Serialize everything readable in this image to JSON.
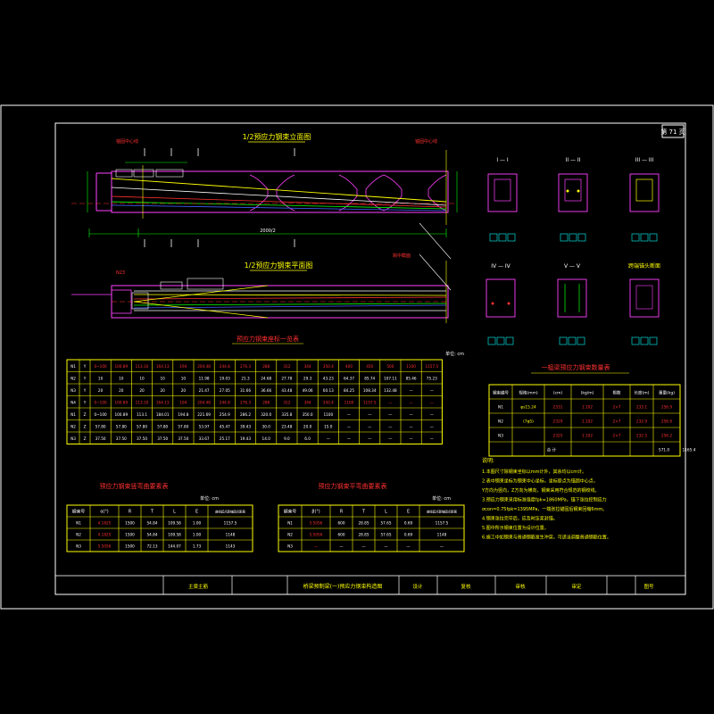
{
  "sheet": {
    "page_label": "第 71 页"
  },
  "elevation": {
    "title": "1/2预应力钢束立面图",
    "anchor_left_label": "锚固中心线",
    "anchor_right_label": "锚固中心线",
    "section_marks": [
      "I",
      "II",
      "III",
      "IV",
      "V"
    ],
    "dim_total": "2000/2"
  },
  "plan": {
    "title": "1/2预应力钢束平面图",
    "left_label": "N23",
    "right_label": "跨中截面"
  },
  "sections": {
    "labels": [
      "I — I",
      "II — II",
      "III — III",
      "IV — IV",
      "V — V",
      "跨端锚头断面"
    ]
  },
  "table_main": {
    "title": "预应力钢束座标一览表",
    "unit": "单位: cm",
    "rows": [
      {
        "c": [
          "N1",
          "Y",
          "0~100",
          "100.89",
          "113.10",
          "164.13",
          "194",
          "204.48",
          "244.8",
          "276.3",
          "288",
          "312",
          "344",
          "350.4",
          "400",
          "450",
          "500",
          "1100",
          "1157.5"
        ]
      },
      {
        "c": [
          "N2",
          "Y",
          "10",
          "10",
          "10",
          "10",
          "10",
          "11.98",
          "19.03",
          "21.3",
          "24.68",
          "27.78",
          "29.3",
          "43.23",
          "64.37",
          "85.74",
          "107.11",
          "85.46",
          "75.23"
        ]
      },
      {
        "c": [
          "N3",
          "Y",
          "20",
          "20",
          "20",
          "20",
          "20",
          "21.47",
          "27.05",
          "31.66",
          "36.66",
          "43.48",
          "49.06",
          "60.13",
          "84.25",
          "108.34",
          "132.48",
          "—",
          "—"
        ]
      },
      {
        "c": [
          "N4",
          "Y",
          "0~100",
          "100.89",
          "113.10",
          "164.13",
          "194",
          "204.48",
          "244.8",
          "276.3",
          "288",
          "312",
          "344",
          "350.4",
          "1100",
          "1157.5",
          "—",
          "—",
          "—"
        ]
      },
      {
        "c": [
          "N1",
          "Z",
          "0~100",
          "100.89",
          "113.1",
          "184.01",
          "194.8",
          "221.69",
          "254.9",
          "286.2",
          "320.0",
          "335.8",
          "350.0",
          "1100",
          "—",
          "—",
          "—",
          "—",
          "—"
        ]
      },
      {
        "c": [
          "N2",
          "Z",
          "57.80",
          "57.80",
          "57.80",
          "57.80",
          "57.80",
          "53.97",
          "45.47",
          "39.43",
          "30.0",
          "23.48",
          "20.0",
          "15.0",
          "—",
          "—",
          "—",
          "—",
          "—"
        ]
      },
      {
        "c": [
          "N3",
          "Z",
          "37.50",
          "37.50",
          "37.50",
          "37.50",
          "37.50",
          "33.67",
          "25.17",
          "19.43",
          "14.0",
          "9.0",
          "6.0",
          "—",
          "—",
          "—",
          "—",
          "—",
          "—"
        ]
      }
    ]
  },
  "table_steel": {
    "title": "一榀梁预应力钢束数量表",
    "headers": [
      "钢束编号",
      "规格(mm)",
      "(cm)",
      "(kg/m)",
      "根数",
      "长度(m)",
      "重量(kg)"
    ],
    "rows": [
      {
        "c": [
          "N1",
          "φs15.24",
          "2331",
          "1.102",
          "2×7",
          "233.1",
          "256.9"
        ]
      },
      {
        "c": [
          "N2",
          "(7φ5)",
          "2329",
          "1.102",
          "2×7",
          "232.9",
          "256.6"
        ]
      },
      {
        "c": [
          "N3",
          "",
          "2325",
          "1.102",
          "2×7",
          "232.5",
          "256.2"
        ]
      }
    ],
    "total_label": "合 计",
    "total_length": "571.0",
    "total_weight": "1165.4"
  },
  "table_vert": {
    "title": "预应力钢束竖弯曲要素表",
    "unit": "单位: cm",
    "headers": [
      "钢束号",
      "α(°)",
      "R",
      "T",
      "L",
      "E",
      "曲线起点距锚固点距离"
    ],
    "rows": [
      {
        "c": [
          "N1",
          "4.1825",
          "1500",
          "54.84",
          "109.58",
          "1.00",
          "1157.5"
        ]
      },
      {
        "c": [
          "N2",
          "4.1825",
          "1500",
          "54.84",
          "109.58",
          "1.00",
          "1148"
        ]
      },
      {
        "c": [
          "N3",
          "5.5056",
          "1500",
          "72.13",
          "144.07",
          "1.73",
          "1143"
        ]
      }
    ]
  },
  "table_horiz": {
    "title": "预应力钢束平弯曲要素表",
    "unit": "单位: cm",
    "headers": [
      "钢束号",
      "β(°)",
      "R",
      "T",
      "L",
      "E",
      "曲线起点距锚固点距离"
    ],
    "rows": [
      {
        "c": [
          "N1",
          "5.5056",
          "600",
          "28.85",
          "57.65",
          "0.69",
          "1157.5"
        ]
      },
      {
        "c": [
          "N2",
          "5.5056",
          "600",
          "28.85",
          "57.65",
          "0.69",
          "1148"
        ]
      },
      {
        "c": [
          "N3",
          "—",
          "—",
          "—",
          "—",
          "—",
          "—"
        ]
      }
    ]
  },
  "notes": {
    "title": "说明:",
    "lines": [
      "1.本图尺寸除钢束坐标以mm计外，其余均以cm计。",
      "2.表中钢束坐标为钢束中心坐标，坐标原点为锚固中心点，",
      "  Y方向为竖向，Z方向为横向，钢束采用符合规范的钢绞线。",
      "3.预应力钢束采用标准强度fpk=1860MPa，锚下张拉控制应力",
      "  σcon=0.75fpk=1395MPa，一端张拉锚固后钢束回缩6mm。",
      "4.钢束张拉完毕后，应及时压浆封锚。",
      "5.图中所示钢束位置为设计位置。",
      "6.施工中如钢束与普通钢筋发生冲突，可适当调整普通钢筋位置。"
    ]
  },
  "title_block": {
    "cells": [
      "主梁主筋",
      "桥梁预制梁(一)预应力钢束构造图",
      "设计",
      "复核",
      "审核",
      "审定",
      "图号"
    ]
  }
}
